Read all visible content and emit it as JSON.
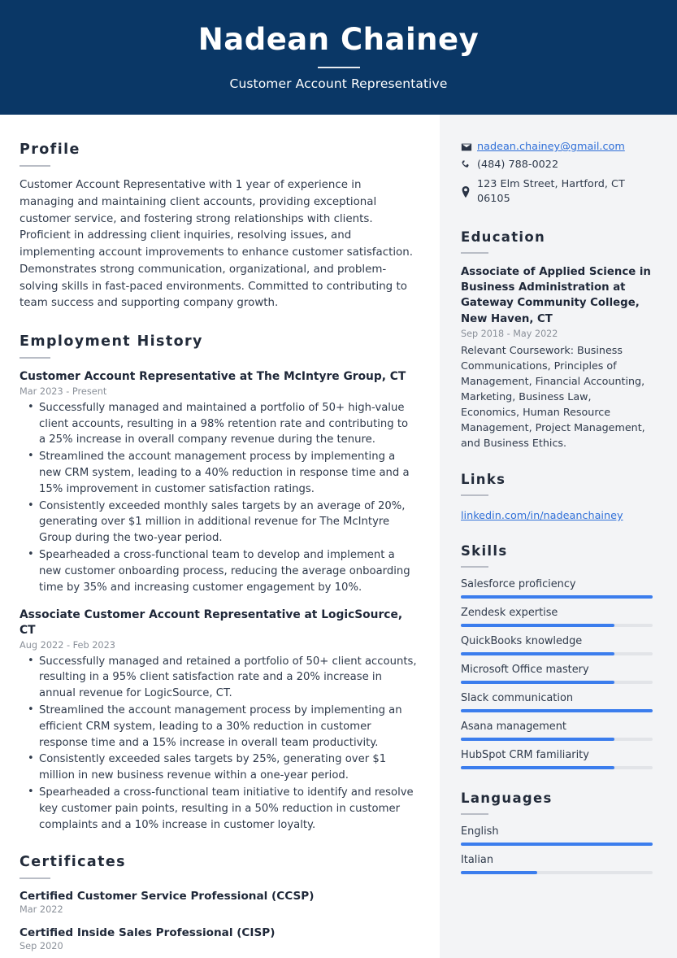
{
  "header": {
    "name": "Nadean Chainey",
    "job_title": "Customer Account Representative",
    "bg_color": "#0a3766"
  },
  "accent_color": "#3b7ded",
  "link_color": "#2f6fd8",
  "sidebar_bg": "#f3f4f6",
  "main": {
    "profile": {
      "heading": "Profile",
      "text": "Customer Account Representative with 1 year of experience in managing and maintaining client accounts, providing exceptional customer service, and fostering strong relationships with clients. Proficient in addressing client inquiries, resolving issues, and implementing account improvements to enhance customer satisfaction. Demonstrates strong communication, organizational, and problem-solving skills in fast-paced environments. Committed to contributing to team success and supporting company growth."
    },
    "employment": {
      "heading": "Employment History",
      "jobs": [
        {
          "title": "Customer Account Representative at The McIntyre Group, CT",
          "date": "Mar 2023 - Present",
          "bullets": [
            "Successfully managed and maintained a portfolio of 50+ high-value client accounts, resulting in a 98% retention rate and contributing to a 25% increase in overall company revenue during the tenure.",
            "Streamlined the account management process by implementing a new CRM system, leading to a 40% reduction in response time and a 15% improvement in customer satisfaction ratings.",
            "Consistently exceeded monthly sales targets by an average of 20%, generating over $1 million in additional revenue for The McIntyre Group during the two-year period.",
            "Spearheaded a cross-functional team to develop and implement a new customer onboarding process, reducing the average onboarding time by 35% and increasing customer engagement by 10%."
          ]
        },
        {
          "title": "Associate Customer Account Representative at LogicSource, CT",
          "date": "Aug 2022 - Feb 2023",
          "bullets": [
            "Successfully managed and retained a portfolio of 50+ client accounts, resulting in a 95% client satisfaction rate and a 20% increase in annual revenue for LogicSource, CT.",
            "Streamlined the account management process by implementing an efficient CRM system, leading to a 30% reduction in customer response time and a 15% increase in overall team productivity.",
            "Consistently exceeded sales targets by 25%, generating over $1 million in new business revenue within a one-year period.",
            "Spearheaded a cross-functional team initiative to identify and resolve key customer pain points, resulting in a 50% reduction in customer complaints and a 10% increase in customer loyalty."
          ]
        }
      ]
    },
    "certificates": {
      "heading": "Certificates",
      "items": [
        {
          "title": "Certified Customer Service Professional (CCSP)",
          "date": "Mar 2022"
        },
        {
          "title": "Certified Inside Sales Professional (CISP)",
          "date": "Sep 2020"
        }
      ]
    }
  },
  "aside": {
    "contact": [
      {
        "icon": "envelope-icon",
        "text": "nadean.chainey@gmail.com",
        "is_link": true
      },
      {
        "icon": "phone-icon",
        "text": "(484) 788-0022",
        "is_link": false
      },
      {
        "icon": "location-pin-icon",
        "text": "123 Elm Street, Hartford, CT 06105",
        "is_link": false
      }
    ],
    "education": {
      "heading": "Education",
      "degree": "Associate of Applied Science in Business Administration at Gateway Community College, New Haven, CT",
      "date": "Sep 2018 - May 2022",
      "description": "Relevant Coursework: Business Communications, Principles of Management, Financial Accounting, Marketing, Business Law, Economics, Human Resource Management, Project Management, and Business Ethics."
    },
    "links": {
      "heading": "Links",
      "items": [
        "linkedin.com/in/nadeanchainey"
      ]
    },
    "skills": {
      "heading": "Skills",
      "items": [
        {
          "name": "Salesforce proficiency",
          "level": 100
        },
        {
          "name": "Zendesk expertise",
          "level": 80
        },
        {
          "name": "QuickBooks knowledge",
          "level": 80
        },
        {
          "name": "Microsoft Office mastery",
          "level": 80
        },
        {
          "name": "Slack communication",
          "level": 100
        },
        {
          "name": "Asana management",
          "level": 80
        },
        {
          "name": "HubSpot CRM familiarity",
          "level": 80
        }
      ]
    },
    "languages": {
      "heading": "Languages",
      "items": [
        {
          "name": "English",
          "level": 100
        },
        {
          "name": "Italian",
          "level": 40
        }
      ]
    }
  }
}
